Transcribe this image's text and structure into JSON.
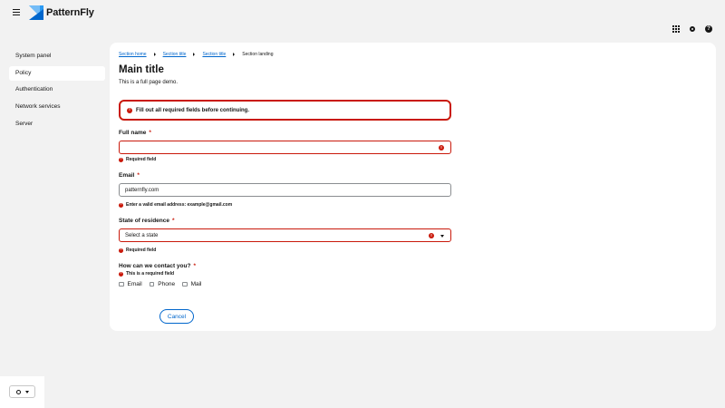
{
  "brand": {
    "name": "PatternFly"
  },
  "icons": {
    "menu": "hamburger-icon",
    "apps": "grid-icon",
    "settings": "gear-icon",
    "help": "help-icon",
    "theme": "sun-icon",
    "error": "exclamation-circle-icon"
  },
  "colors": {
    "accent": "#0066cc",
    "danger": "#c9190b",
    "background": "#f2f2f2"
  },
  "sidebar": {
    "items": [
      {
        "label": "System panel"
      },
      {
        "label": "Policy",
        "active": true
      },
      {
        "label": "Authentication"
      },
      {
        "label": "Network services"
      },
      {
        "label": "Server"
      }
    ]
  },
  "breadcrumb": {
    "items": [
      "Section home",
      "Section title",
      "Section title"
    ],
    "current": "Section landing"
  },
  "page": {
    "title": "Main title",
    "subtitle": "This is a full page demo."
  },
  "alert": {
    "text": "Fill out all required fields before continuing."
  },
  "form": {
    "required_mark": "*",
    "full_name": {
      "label": "Full name",
      "value": "",
      "helper": "Required field"
    },
    "email": {
      "label": "Email",
      "value": "patternfly.com",
      "helper": "Enter a valid email address: example@gmail.com"
    },
    "state": {
      "label": "State of residence",
      "value": "Select a state",
      "helper": "Required field"
    },
    "contact": {
      "label": "How can we contact you?",
      "helper": "This is a required field",
      "options": [
        "Email",
        "Phone",
        "Mail"
      ]
    },
    "cancel_label": "Cancel"
  }
}
